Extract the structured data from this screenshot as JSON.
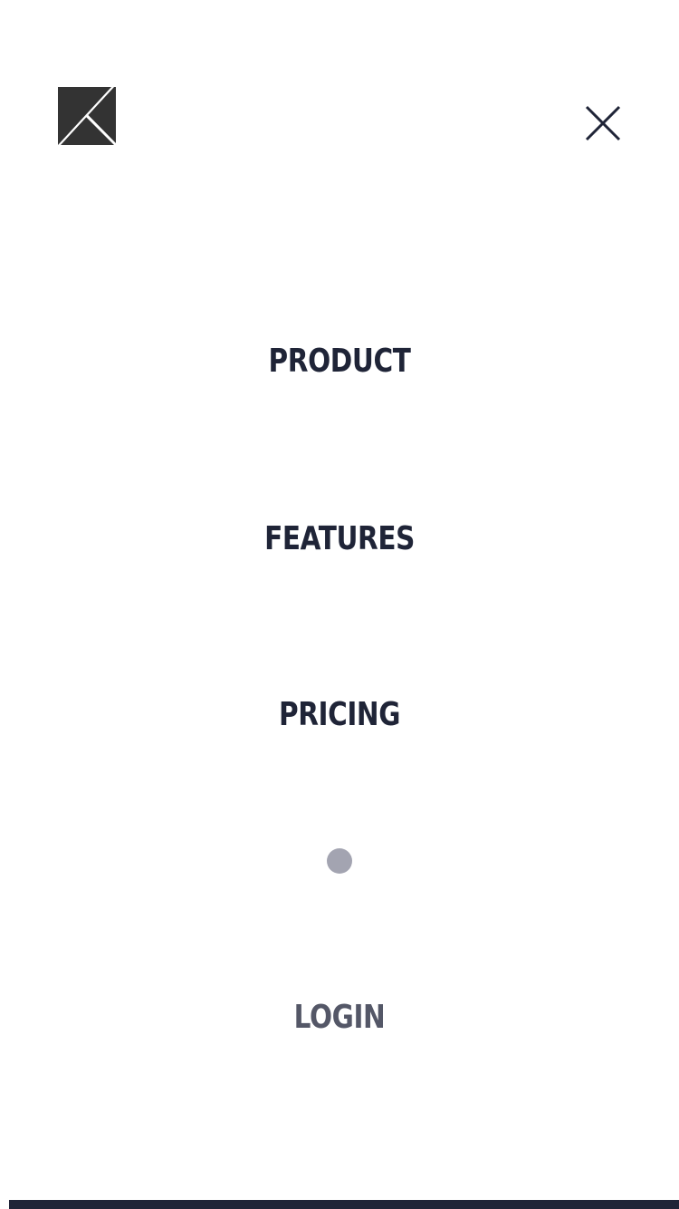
{
  "header": {
    "logo_icon": "k-logo-icon",
    "close_icon": "close-icon"
  },
  "menu": {
    "items": [
      {
        "label": "PRODUCT"
      },
      {
        "label": "FEATURES"
      },
      {
        "label": "PRICING"
      }
    ],
    "login_label": "LOGIN"
  },
  "colors": {
    "primary_text": "#1f2437",
    "muted_text": "#545767",
    "dot": "#a3a4b1",
    "logo": "#333333"
  }
}
